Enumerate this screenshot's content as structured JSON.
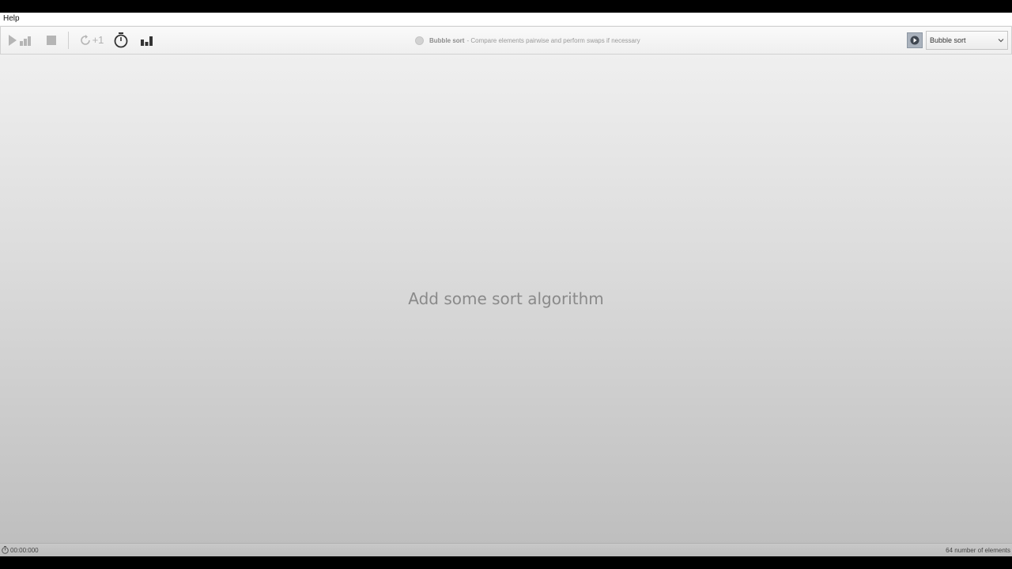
{
  "menu": {
    "help_label": "Help"
  },
  "toolbar": {
    "play_icon": "play-bars-icon",
    "stop_icon": "stop-icon",
    "step_icon": "refresh-icon",
    "step_label": "+1",
    "timer_icon": "stopwatch-icon",
    "bars_icon": "bar-chart-icon"
  },
  "status": {
    "algorithm_name": "Bubble sort",
    "algorithm_desc": "- Compare elements pairwise and perform swaps if necessary"
  },
  "algorithm_select": {
    "selected": "Bubble sort",
    "info_icon": "info-icon"
  },
  "main": {
    "empty_message": "Add some sort algorithm"
  },
  "statusbar": {
    "elapsed": "00:00:000",
    "element_count": "64 number of elements"
  },
  "colors": {
    "disabled_icon": "#b5b5b5",
    "active_icon": "#333333",
    "info_button": "#aab2bd"
  }
}
